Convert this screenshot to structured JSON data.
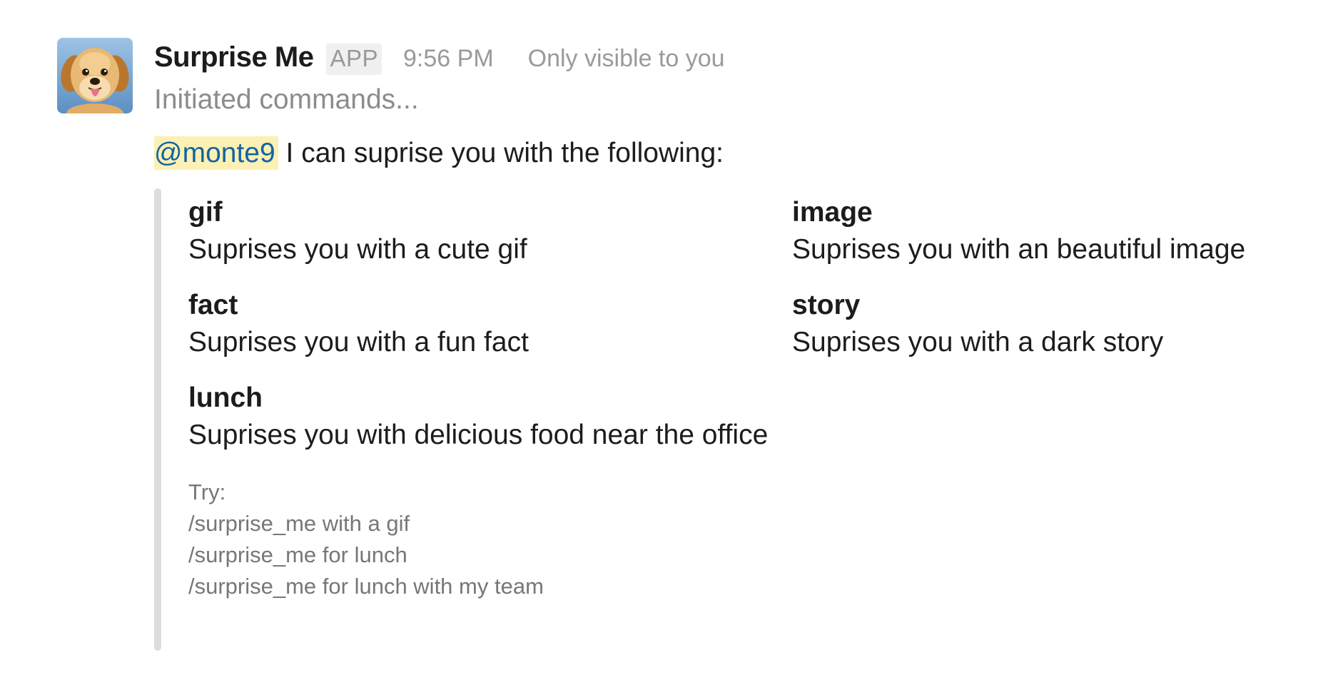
{
  "message": {
    "sender": "Surprise Me",
    "badge": "APP",
    "time": "9:56 PM",
    "visibility": "Only visible to you",
    "subtext": "Initiated commands...",
    "mention": "@monte9",
    "intro_text": " I can suprise you with the following:",
    "avatar_icon": "golden-retriever-puppy-avatar"
  },
  "attachment": {
    "bar_color": "#dddddd",
    "fields": [
      {
        "title": "gif",
        "value": "Suprises you with a cute gif"
      },
      {
        "title": "image",
        "value": "Suprises you with an beautiful image"
      },
      {
        "title": "fact",
        "value": "Suprises you with a fun fact"
      },
      {
        "title": "story",
        "value": "Suprises you with a dark story"
      },
      {
        "title": "lunch",
        "value": "Suprises you with delicious food near the office"
      }
    ],
    "footer": {
      "label": "Try:",
      "examples": [
        "/surprise_me with a gif",
        "/surprise_me for lunch",
        "/surprise_me for lunch with my team"
      ]
    }
  },
  "colors": {
    "mention_bg": "#fdf0b4",
    "mention_text": "#1264a3",
    "muted_text": "#9a9a9a"
  }
}
